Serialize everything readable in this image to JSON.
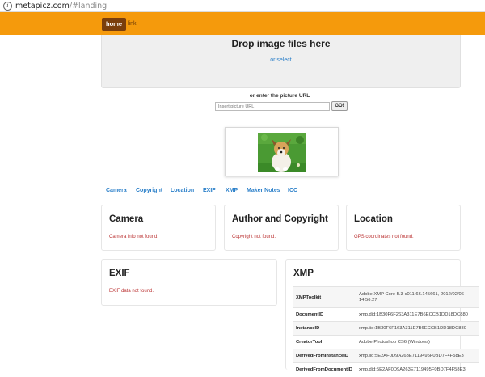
{
  "browser": {
    "url_host": "metapicz.com",
    "url_path": "/#landing"
  },
  "nav": {
    "home": "home",
    "link": "link"
  },
  "dropzone": {
    "title": "Drop image files here",
    "or_select": "or select"
  },
  "url_entry": {
    "label": "or enter the picture URL",
    "placeholder": "Insert picture URL",
    "go": "GO!"
  },
  "tabs": [
    "Camera",
    "Copyright",
    "Location",
    "EXIF",
    "XMP",
    "Maker Notes",
    "ICC"
  ],
  "cards": {
    "camera": {
      "title": "Camera",
      "message": "Camera info not found."
    },
    "author": {
      "title": "Author and Copyright",
      "message": "Copyright not found."
    },
    "location": {
      "title": "Location",
      "message": "GPS coordinates not found."
    },
    "exif": {
      "title": "EXIF",
      "message": "EXIF data not found."
    },
    "xmp": {
      "title": "XMP",
      "rows": [
        {
          "key": "XMPToolkit",
          "value": "Adobe XMP Core 5.3-c011 66.145661, 2012/02/06-14:56:27"
        },
        {
          "key": "DocumentID",
          "value": "xmp.did:1B30F6F263A311E7B6ECCB1DD18DC880"
        },
        {
          "key": "InstanceID",
          "value": "xmp.iid:1B30F6F163A311E7B6ECCB1DD18DC880"
        },
        {
          "key": "CreatorTool",
          "value": "Adobe Photoshop CS6 (Windows)"
        },
        {
          "key": "DerivedFromInstanceID",
          "value": "xmp.iid:5E2AF0D9A263E7119495F0BD7F4F58E3"
        },
        {
          "key": "DerivedFromDocumentID",
          "value": "xmp.did:5E2AF0D9A263E7119495F0BD7F4F58E3"
        }
      ]
    }
  },
  "colors": {
    "navbar": "#f59a0c",
    "home_button": "#7a3e0c",
    "link_blue": "#2a7fc9",
    "error_red": "#b33333"
  }
}
